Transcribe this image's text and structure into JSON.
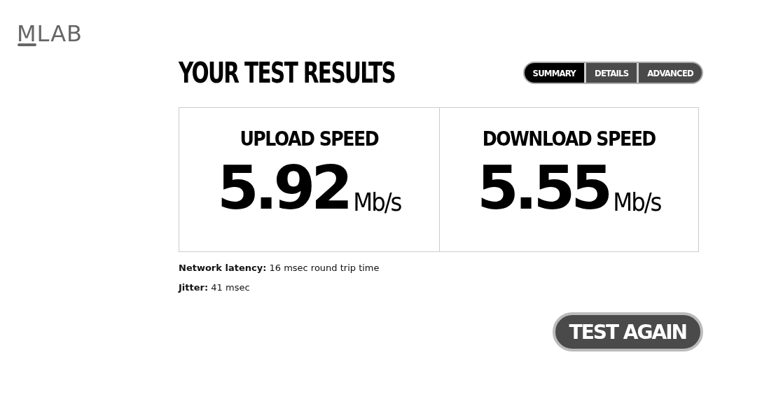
{
  "logo": "MLAB",
  "title": "YOUR TEST RESULTS",
  "tabs": [
    {
      "label": "SUMMARY",
      "selected": true
    },
    {
      "label": "DETAILS",
      "selected": false
    },
    {
      "label": "ADVANCED",
      "selected": false
    }
  ],
  "speeds": [
    {
      "label": "UPLOAD SPEED",
      "value": "5.92",
      "unit": "Mb/s"
    },
    {
      "label": "DOWNLOAD SPEED",
      "value": "5.55",
      "unit": "Mb/s"
    }
  ],
  "stats": [
    {
      "label": "Network latency:",
      "value": "16 msec round trip time"
    },
    {
      "label": "Jitter:",
      "value": "41 msec"
    }
  ],
  "button": "TEST AGAIN"
}
